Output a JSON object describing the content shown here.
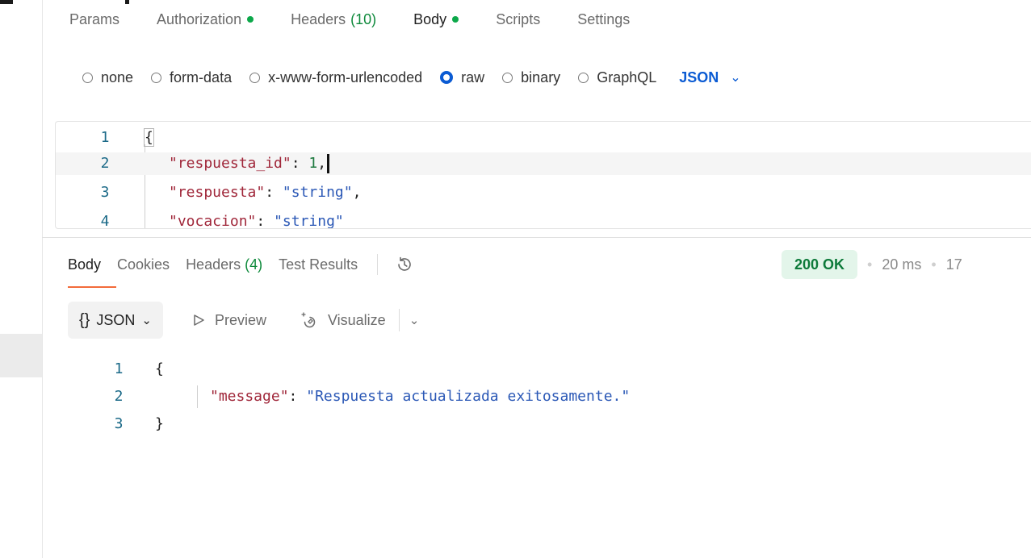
{
  "request_tabs": {
    "params": "Params",
    "authorization": "Authorization",
    "headers": "Headers",
    "headers_count": "(10)",
    "body": "Body",
    "scripts": "Scripts",
    "settings": "Settings"
  },
  "body_types": {
    "none": "none",
    "form_data": "form-data",
    "urlencoded": "x-www-form-urlencoded",
    "raw": "raw",
    "binary": "binary",
    "graphql": "GraphQL",
    "selected": "raw",
    "language": "JSON"
  },
  "request_editor": {
    "lines": [
      {
        "num": "1",
        "open": "{"
      },
      {
        "num": "2",
        "key": "\"respuesta_id\"",
        "colon": ": ",
        "value": "1",
        "end": ","
      },
      {
        "num": "3",
        "key": "\"respuesta\"",
        "colon": ": ",
        "value": "\"string\"",
        "end": ","
      },
      {
        "num": "4",
        "key": "\"vocacion\"",
        "colon": ": ",
        "value": "\"string\"",
        "end": ""
      }
    ]
  },
  "response_tabs": {
    "body": "Body",
    "cookies": "Cookies",
    "headers": "Headers",
    "headers_count": "(4)",
    "test_results": "Test Results"
  },
  "status": {
    "code": "200 OK",
    "time": "20 ms",
    "size": "17"
  },
  "response_toolbar": {
    "format": "JSON",
    "preview": "Preview",
    "visualize": "Visualize"
  },
  "response_body": {
    "lines": [
      {
        "num": "1",
        "text": "{"
      },
      {
        "num": "2",
        "key": "\"message\"",
        "colon": ": ",
        "value": "\"Respuesta actualizada exitosamente.\""
      },
      {
        "num": "3",
        "text": "}"
      }
    ]
  },
  "colors": {
    "accent_blue": "#0b5bd3",
    "success_green": "#0ca84a",
    "tab_underline": "#f26b3a"
  }
}
